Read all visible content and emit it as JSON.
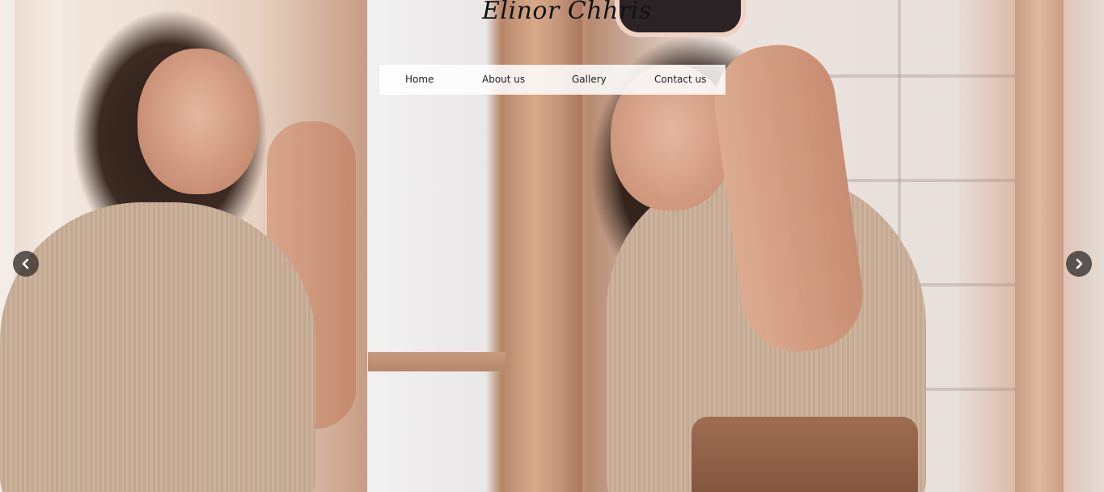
{
  "brand": {
    "logo_text": "Elinor Chhris"
  },
  "nav": {
    "items": [
      {
        "label": "Home"
      },
      {
        "label": "About us"
      },
      {
        "label": "Gallery"
      },
      {
        "label": "Contact us"
      }
    ]
  },
  "carousel": {
    "prev_icon": "chevron-left-icon",
    "next_icon": "chevron-right-icon",
    "arrow_color": "#3c3734"
  },
  "theme": {
    "nav_background": "#ffffff",
    "text_color": "#222222"
  }
}
